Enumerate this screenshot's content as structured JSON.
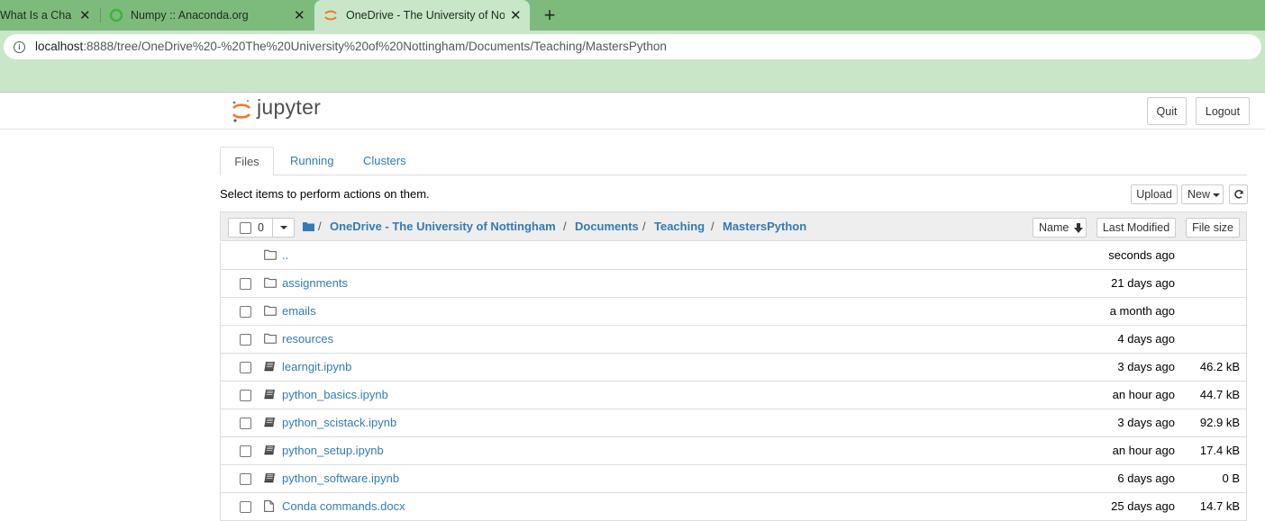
{
  "browser": {
    "tabs": [
      {
        "title": "What Is a Chan",
        "active": false
      },
      {
        "title": "Numpy :: Anaconda.org",
        "active": false
      },
      {
        "title": "OneDrive - The University of Nott",
        "active": true
      }
    ],
    "url_host": "localhost",
    "url_path": ":8888/tree/OneDrive%20-%20The%20University%20of%20Nottingham/Documents/Teaching/MastersPython"
  },
  "header": {
    "logo_text": "jupyter",
    "quit_label": "Quit",
    "logout_label": "Logout"
  },
  "nav": {
    "tabs": [
      "Files",
      "Running",
      "Clusters"
    ],
    "active": "Files"
  },
  "toolbar": {
    "instructions": "Select items to perform actions on them.",
    "upload_label": "Upload",
    "new_label": "New"
  },
  "list": {
    "selected_count": "0",
    "breadcrumbs": [
      "OneDrive - The University of Nottingham",
      "Documents",
      "Teaching",
      "MastersPython"
    ],
    "breadcrumb_sep": "/",
    "col_name": "Name",
    "col_modified": "Last Modified",
    "col_size": "File size",
    "rows": [
      {
        "name": "..",
        "type": "folder",
        "modified": "seconds ago",
        "size": "",
        "checkbox": false
      },
      {
        "name": "assignments",
        "type": "folder",
        "modified": "21 days ago",
        "size": "",
        "checkbox": true
      },
      {
        "name": "emails",
        "type": "folder",
        "modified": "a month ago",
        "size": "",
        "checkbox": true
      },
      {
        "name": "resources",
        "type": "folder",
        "modified": "4 days ago",
        "size": "",
        "checkbox": true
      },
      {
        "name": "learngit.ipynb",
        "type": "notebook",
        "modified": "3 days ago",
        "size": "46.2 kB",
        "checkbox": true
      },
      {
        "name": "python_basics.ipynb",
        "type": "notebook",
        "modified": "an hour ago",
        "size": "44.7 kB",
        "checkbox": true
      },
      {
        "name": "python_scistack.ipynb",
        "type": "notebook",
        "modified": "3 days ago",
        "size": "92.9 kB",
        "checkbox": true
      },
      {
        "name": "python_setup.ipynb",
        "type": "notebook",
        "modified": "an hour ago",
        "size": "17.4 kB",
        "checkbox": true
      },
      {
        "name": "python_software.ipynb",
        "type": "notebook",
        "modified": "6 days ago",
        "size": "0 B",
        "checkbox": true
      },
      {
        "name": "Conda commands.docx",
        "type": "file",
        "modified": "25 days ago",
        "size": "14.7 kB",
        "checkbox": true
      }
    ]
  }
}
